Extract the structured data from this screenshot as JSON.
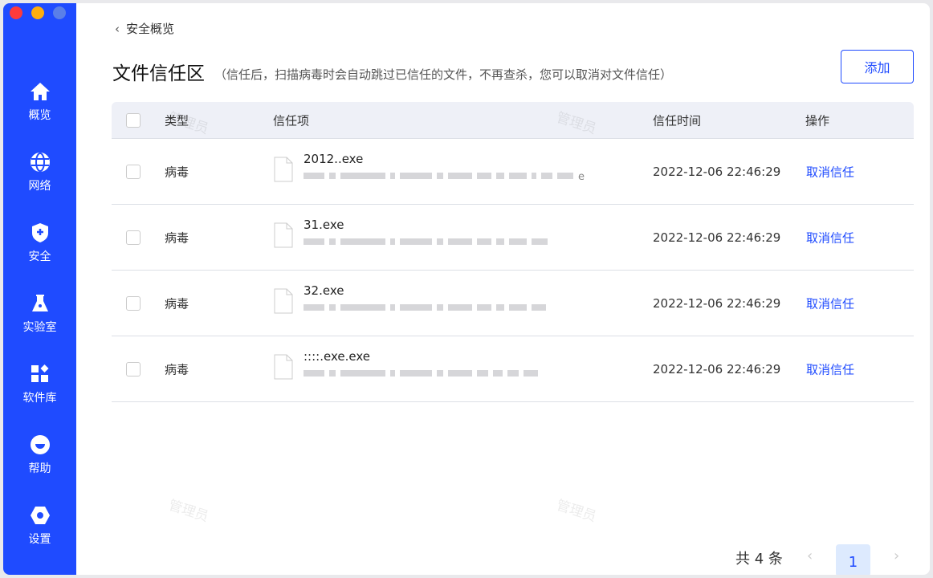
{
  "window": {
    "controls": [
      "close",
      "minimize",
      "maximize"
    ]
  },
  "sidebar": {
    "items": [
      {
        "label": "概览",
        "icon": "home-icon"
      },
      {
        "label": "网络",
        "icon": "globe-icon"
      },
      {
        "label": "安全",
        "icon": "shield-icon"
      },
      {
        "label": "实验室",
        "icon": "flask-icon"
      },
      {
        "label": "软件库",
        "icon": "apps-icon"
      },
      {
        "label": "帮助",
        "icon": "help-icon"
      },
      {
        "label": "设置",
        "icon": "gear-icon"
      }
    ]
  },
  "header": {
    "back_label": "安全概览",
    "title": "文件信任区",
    "subtitle": "（信任后，扫描病毒时会自动跳过已信任的文件，不再查杀，您可以取消对文件信任）",
    "add_label": "添加"
  },
  "table": {
    "columns": [
      "类型",
      "信任项",
      "信任时间",
      "操作"
    ],
    "rows": [
      {
        "type": "病毒",
        "name": "2012..exe",
        "time": "2022-12-06 22:46:29",
        "action": "取消信任",
        "path_tail": "e"
      },
      {
        "type": "病毒",
        "name": "31.exe",
        "time": "2022-12-06 22:46:29",
        "action": "取消信任"
      },
      {
        "type": "病毒",
        "name": "32.exe",
        "time": "2022-12-06 22:46:29",
        "action": "取消信任"
      },
      {
        "type": "病毒",
        "name": "::::.exe.exe",
        "time": "2022-12-06 22:46:29",
        "action": "取消信任"
      }
    ]
  },
  "pagination": {
    "total": "共 4 条",
    "current": "1"
  },
  "watermark": "管理员",
  "colors": {
    "accent": "#1f4bff"
  }
}
